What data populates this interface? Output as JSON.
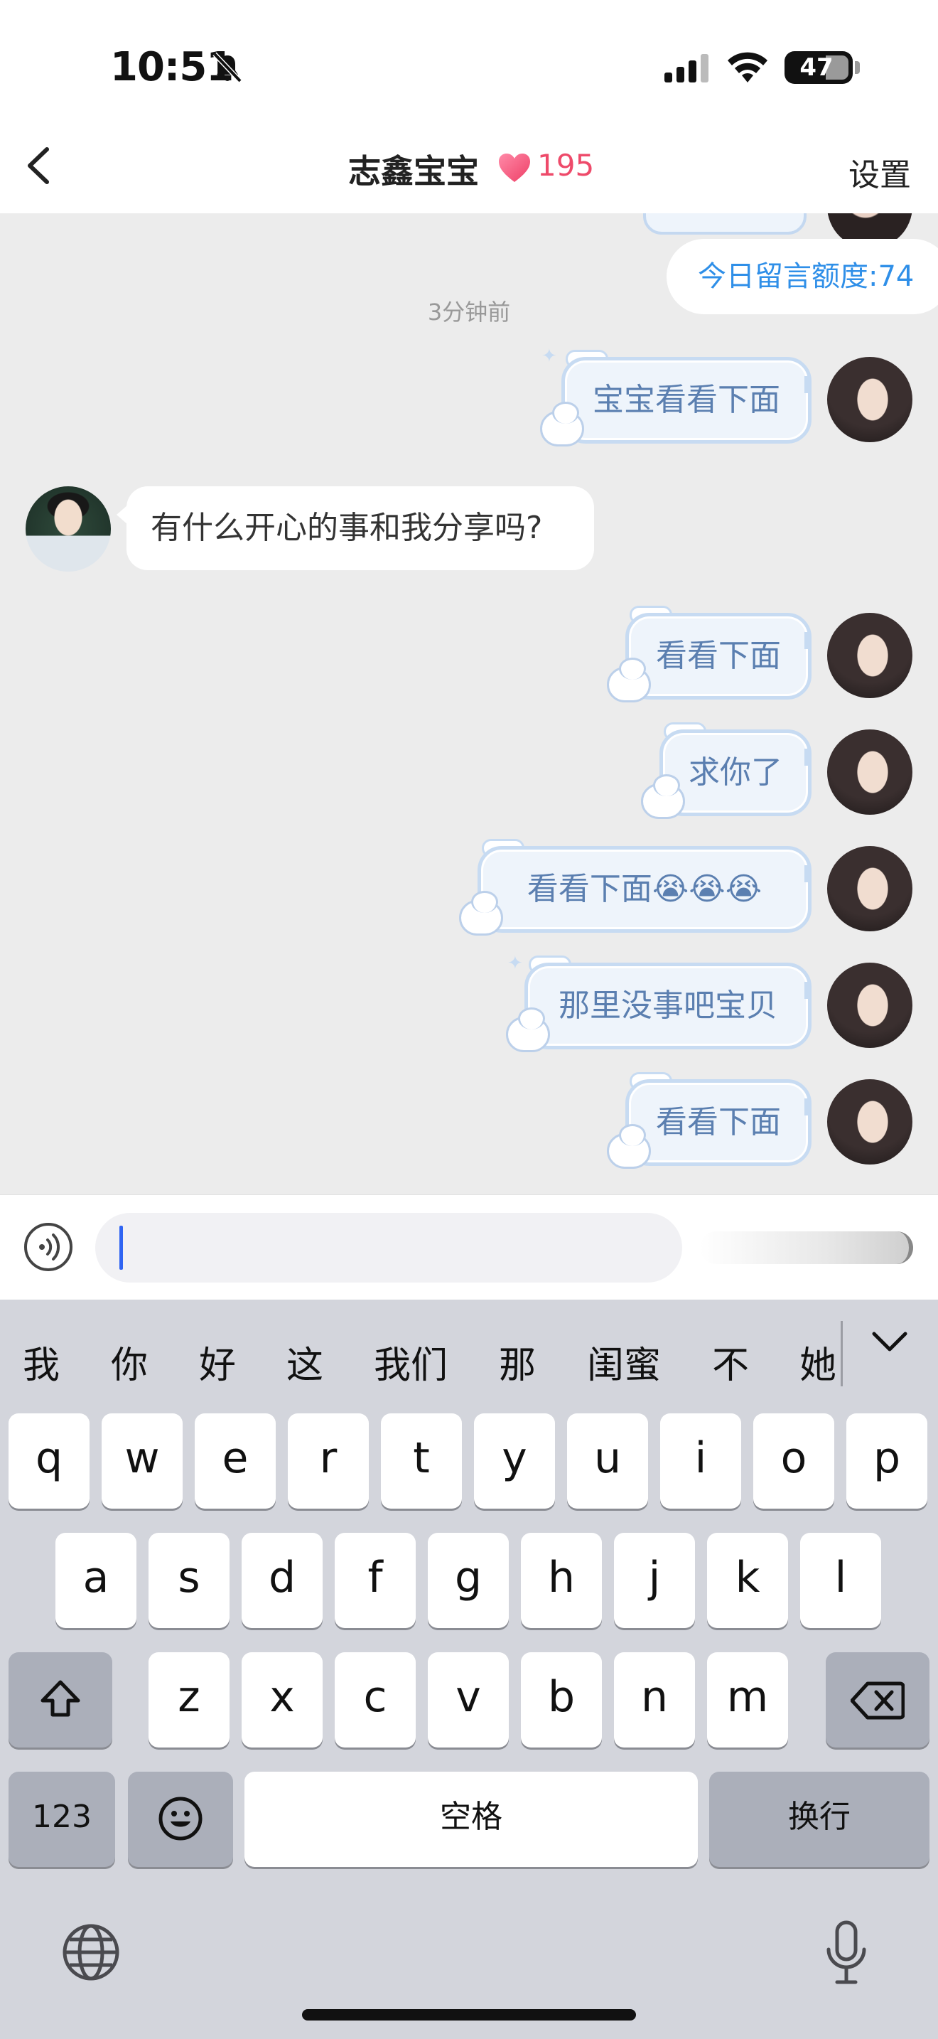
{
  "status_bar": {
    "time": "10:51",
    "battery": "47"
  },
  "header": {
    "title": "志鑫宝宝",
    "count": "195",
    "settings_label": "设置"
  },
  "chat": {
    "quota": "今日留言额度:74",
    "timestamp": "3分钟前",
    "messages": [
      {
        "from": "me",
        "text": "宝宝看看下面"
      },
      {
        "from": "him",
        "text": "有什么开心的事和我分享吗?"
      },
      {
        "from": "me",
        "text": "看看下面"
      },
      {
        "from": "me",
        "text": "求你了"
      },
      {
        "from": "me",
        "text": "看看下面😭😭😭"
      },
      {
        "from": "me",
        "text": "那里没事吧宝贝"
      },
      {
        "from": "me",
        "text": "看看下面"
      }
    ]
  },
  "input": {
    "value": ""
  },
  "keyboard": {
    "candidates": [
      "我",
      "你",
      "好",
      "这",
      "我们",
      "那",
      "闺蜜",
      "不",
      "她"
    ],
    "row1": [
      "q",
      "w",
      "e",
      "r",
      "t",
      "y",
      "u",
      "i",
      "o",
      "p"
    ],
    "row2": [
      "a",
      "s",
      "d",
      "f",
      "g",
      "h",
      "j",
      "k",
      "l"
    ],
    "row3": [
      "z",
      "x",
      "c",
      "v",
      "b",
      "n",
      "m"
    ],
    "numbers_label": "123",
    "space_label": "空格",
    "return_label": "换行"
  },
  "colors": {
    "accent_blue": "#2f8fe8",
    "heart_pink": "#ee4a6a",
    "bubble_text": "#5b7fb0",
    "chat_bg": "#ececec",
    "keyboard_bg": "#d3d5dc"
  }
}
